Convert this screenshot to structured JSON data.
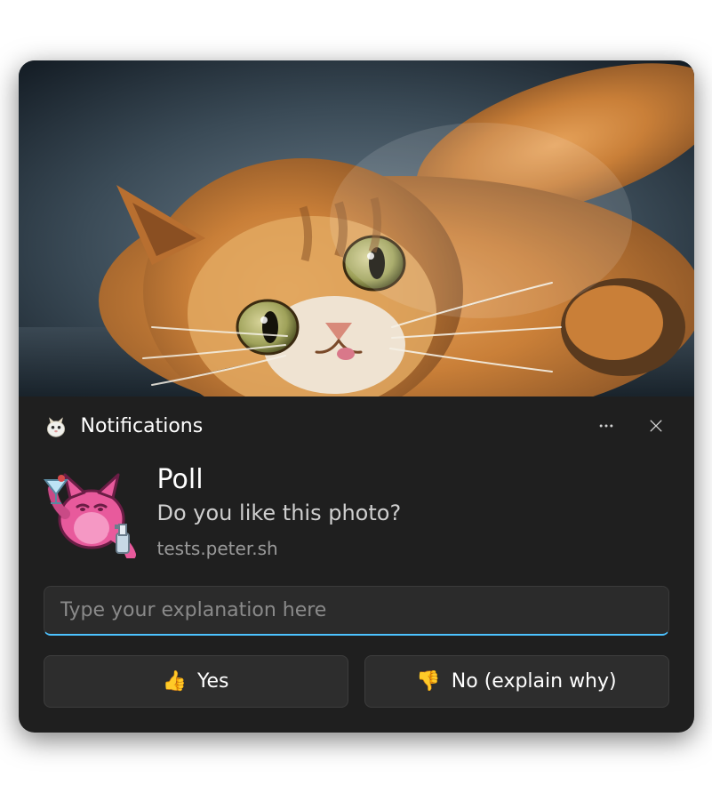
{
  "header": {
    "app_label": "Notifications"
  },
  "content": {
    "title": "Poll",
    "body": "Do you like this photo?",
    "source": "tests.peter.sh"
  },
  "input": {
    "placeholder": "Type your explanation here"
  },
  "actions": {
    "yes": {
      "icon": "👍",
      "label": "Yes"
    },
    "no": {
      "icon": "👎",
      "label": "No (explain why)"
    }
  },
  "icons": {
    "app": "hamster-icon",
    "more": "more-horizontal-icon",
    "close": "close-icon",
    "avatar": "pink-cat-avatar"
  }
}
